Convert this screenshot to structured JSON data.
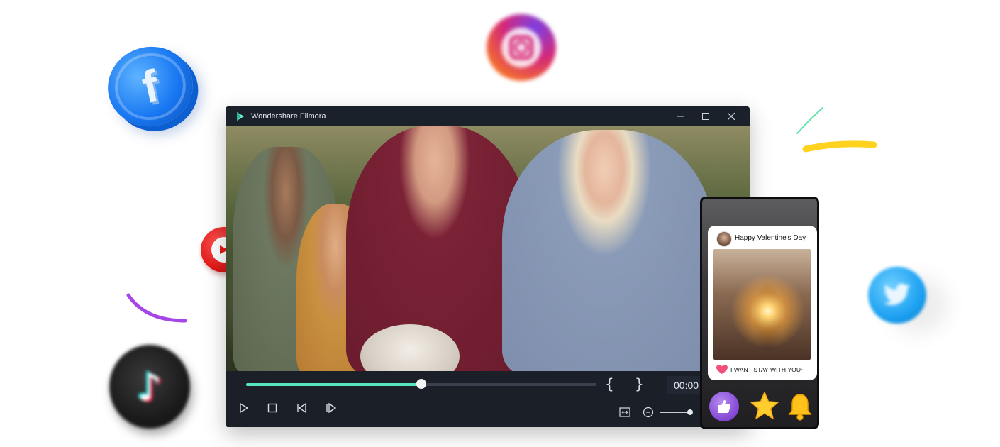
{
  "window": {
    "title": "Wondershare Filmora",
    "controls": [
      "minimize",
      "maximize",
      "close"
    ]
  },
  "player": {
    "progress": 0.5,
    "in_marker": "{",
    "out_marker": "}",
    "timecode": "00:00",
    "accent_color": "#58e6c1"
  },
  "phone_post": {
    "title": "Happy Valentine's Day",
    "caption": "I WANT STAY WITH YOU~",
    "reactions": [
      "thumbs-up-icon",
      "star-icon",
      "bell-icon"
    ]
  },
  "social_icons": [
    "facebook-icon",
    "instagram-icon",
    "youtube-icon",
    "twitter-icon",
    "tiktok-icon"
  ],
  "icons": {
    "facebook_letter": "f",
    "tiktok_glyph": "♪"
  },
  "colors": {
    "facebook": "#1877f2",
    "youtube": "#e21a1a",
    "twitter": "#1da1f2",
    "stroke_yellow": "#ffd21f",
    "stroke_green": "#5ee0a6",
    "stroke_purple": "#a646e8"
  }
}
